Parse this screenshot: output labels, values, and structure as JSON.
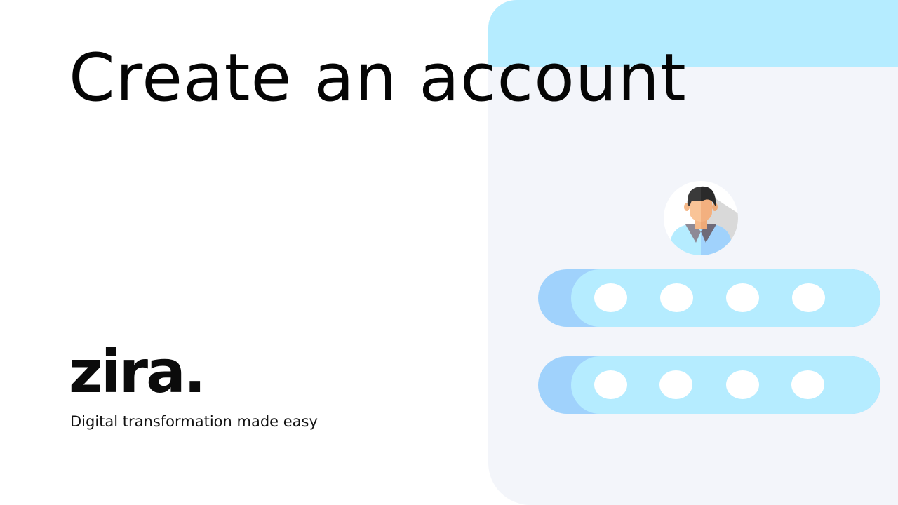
{
  "page": {
    "title": "Create an account"
  },
  "brand": {
    "logo_text": "zira.",
    "tagline": "Digital transformation made easy"
  },
  "illustration": {
    "avatar_icon": "user-avatar-icon",
    "fields": [
      {
        "name": "username-field",
        "dots": 4
      },
      {
        "name": "password-field",
        "dots": 4
      }
    ]
  },
  "colors": {
    "panel_background": "#f3f5fa",
    "panel_header": "#b5ecff",
    "field_fill": "#b5ecff",
    "field_accent": "#a0d2fc",
    "text": "#050505"
  }
}
